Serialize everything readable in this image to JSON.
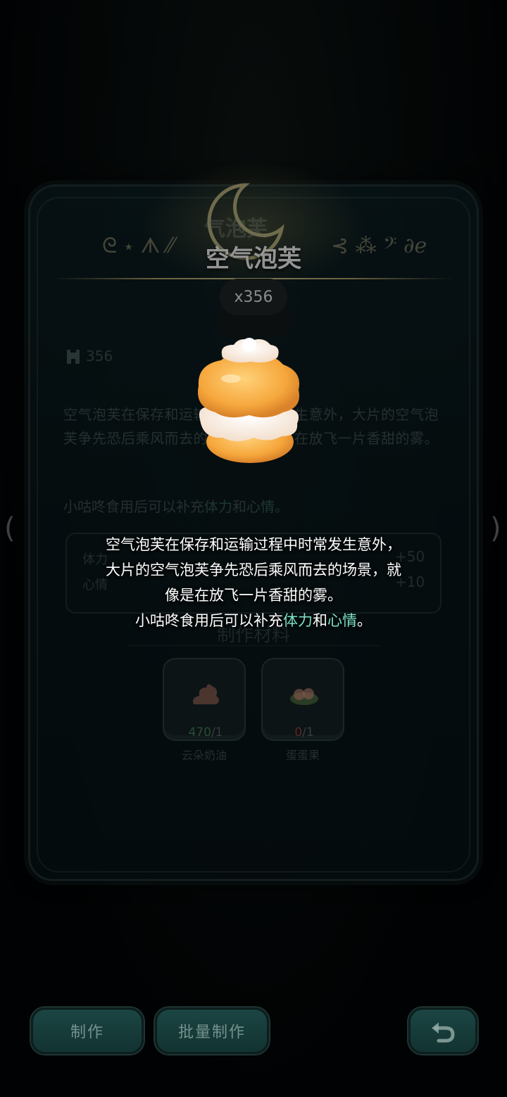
{
  "item": {
    "title": "空气泡芙",
    "count_badge": "x356",
    "stock": "356"
  },
  "background": {
    "header_ghost": "气泡芙",
    "description": "空气泡芙在保存和运输过程中时常发生意外，大片的空气泡芙争先恐后乘风而去的场景，就像是在放飞一片香甜的雾。",
    "effect_prefix": "小咕咚食用后可以补充",
    "effect_stat1": "体力",
    "effect_and": "和",
    "effect_stat2": "心情",
    "effect_suffix": "。",
    "effects": [
      {
        "label": "体力",
        "value": "+50"
      },
      {
        "label": "心情",
        "value": "+10"
      }
    ],
    "materials_title": "制作材料",
    "materials": [
      {
        "name": "云朵奶油",
        "have": "470",
        "need": "/1",
        "icon": "cream-icon"
      },
      {
        "name": "蛋蛋果",
        "have": "0",
        "need": "/1",
        "icon": "egg-fruit-icon"
      }
    ]
  },
  "tooltip": {
    "line1": "空气泡芙在保存和运输过程中时常发生意外，",
    "line2": "大片的空气泡芙争先恐后乘风而去的场景，就",
    "line3": "像是在放飞一片香甜的雾。",
    "line4_prefix": "小咕咚食用后可以补充",
    "line4_stat1": "体力",
    "line4_and": "和",
    "line4_stat2": "心情",
    "line4_suffix": "。"
  },
  "buttons": {
    "make": "制作",
    "batch_make": "批量制作",
    "back_icon": "undo-arrow-icon"
  },
  "colors": {
    "highlight": "#7ee3c9",
    "button_bg": "#1b4543",
    "panel_bg": "#0f2429"
  }
}
